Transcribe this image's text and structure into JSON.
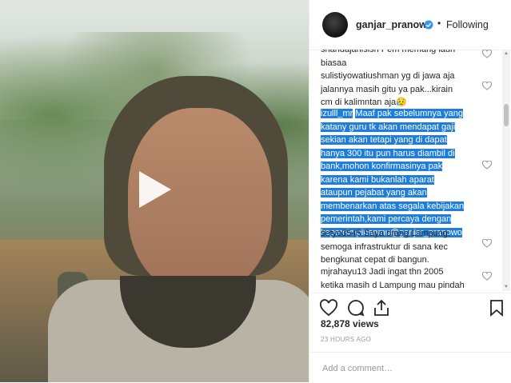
{
  "video": {
    "play_icon": "play-icon"
  },
  "post": {
    "username": "ganjar_pranowo",
    "verified_icon": "verified-badge-icon",
    "separator": "•",
    "follow_status": "Following"
  },
  "comments": [
    {
      "text": "shandajanisish Pem memang lauh",
      "line2": "biasaa"
    },
    {
      "author": "sulistiyowatiushman",
      "text": " yg di jawa aja",
      "line2": "jalannya masih gitu ya pak...kirain",
      "line3": "cm di kalimntan aja",
      "emoji": "😥"
    },
    {
      "author": "izulll_mr",
      "lines": [
        "Maaf pak sebelumnya yang",
        "katany guru tk akan mendapat gaji",
        "sekian akan tetapi yang di dapat",
        "hanya 300 itu pun harus diambil di",
        "bank,mohon konfirmasinya pak",
        "karena kami bukanlah aparat",
        "ataupun pejabat yang akan",
        "membenarkan atas segala kebijakan",
        "pemerintah,kami percaya dengan",
        "kepemimpinanmu@ganjar_pranowo"
      ]
    },
    {
      "author": "setyo3545",
      "text": " Saya orang Lampung,",
      "line2": "semoga infrastruktur di sana kec",
      "line3": "bengkunat cepat di bangun."
    },
    {
      "author": "mjrahayu13",
      "text": " Jadi ingat thn 2005",
      "line2": "ketika masih d Lampung mau pindah"
    }
  ],
  "stats": {
    "views": "82,878 views",
    "time_ago": "23 HOURS AGO"
  },
  "add_comment": {
    "placeholder": "Add a comment…"
  },
  "icons": [
    "heart-icon",
    "comment-icon",
    "share-icon",
    "bookmark-icon"
  ]
}
